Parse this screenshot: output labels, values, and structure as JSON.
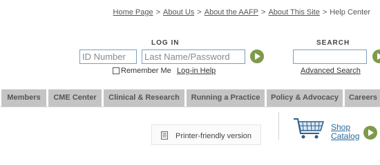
{
  "breadcrumb": {
    "items": [
      "Home Page",
      "About Us",
      "About the AAFP",
      "About This Site"
    ],
    "current": "Help Center",
    "separator": ">"
  },
  "login": {
    "heading": "LOG IN",
    "id_placeholder": "ID Number",
    "password_placeholder": "Last Name/Password",
    "remember_label": "Remember Me",
    "help_link": "Log-in Help"
  },
  "search": {
    "heading": "SEARCH",
    "advanced_link": "Advanced Search"
  },
  "nav": {
    "tabs": [
      "Members",
      "CME Center",
      "Clinical & Research",
      "Running a Practice",
      "Policy & Advocacy",
      "Careers"
    ]
  },
  "content": {
    "printer_label": "Printer-friendly version",
    "shop_catalog": "Shop Catalog"
  },
  "colors": {
    "accent_green": "#7e9a4a",
    "tab_gray": "#c4c4c4",
    "input_border": "#7a9ec0",
    "link_blue": "#2a6a9a"
  },
  "icons": {
    "go": "arrow-right-circle",
    "printer": "document-icon",
    "cart": "shopping-cart-icon"
  }
}
